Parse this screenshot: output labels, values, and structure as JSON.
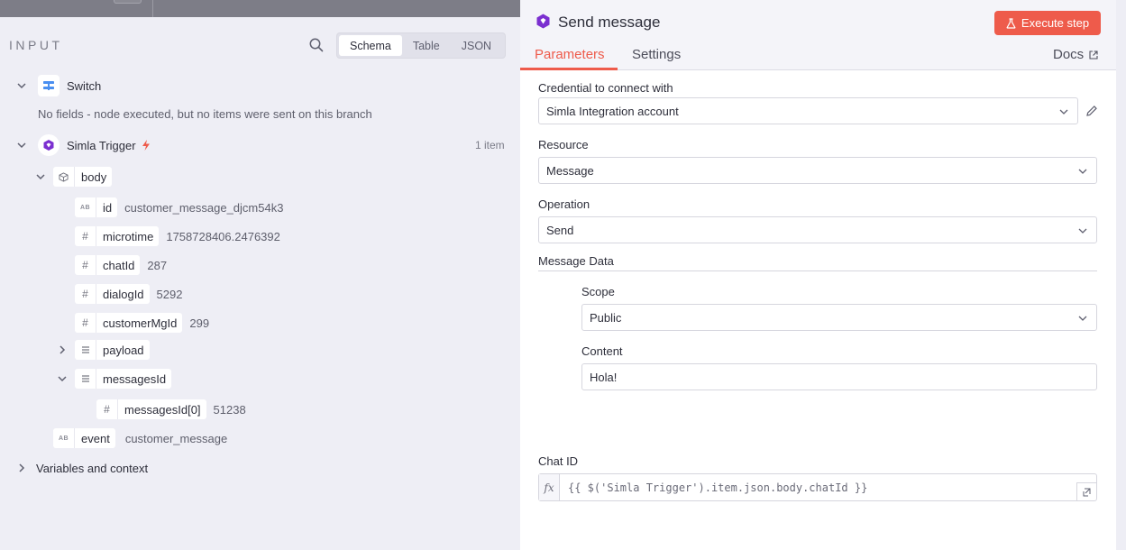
{
  "input_panel": {
    "title": "INPUT",
    "view_tabs": [
      "Schema",
      "Table",
      "JSON"
    ],
    "active_view": "Schema",
    "switch_node": {
      "label": "Switch",
      "message": "No fields - node executed, but no items were sent on this branch"
    },
    "trigger_node": {
      "label": "Simla Trigger",
      "count": "1 item"
    },
    "body_label": "body",
    "fields": [
      {
        "type": "AB",
        "name": "id",
        "value": "customer_message_djcm54k3"
      },
      {
        "type": "#",
        "name": "microtime",
        "value": "1758728406.2476392"
      },
      {
        "type": "#",
        "name": "chatId",
        "value": "287"
      },
      {
        "type": "#",
        "name": "dialogId",
        "value": "5292"
      },
      {
        "type": "#",
        "name": "customerMgId",
        "value": "299"
      }
    ],
    "payload_label": "payload",
    "messages_label": "messagesId",
    "messages_item": {
      "type": "#",
      "name": "messagesId[0]",
      "value": "51238"
    },
    "event": {
      "type": "AB",
      "name": "event",
      "value": "customer_message"
    },
    "variables_label": "Variables and context"
  },
  "node_panel": {
    "title": "Send message",
    "execute_label": "Execute step",
    "tabs": [
      "Parameters",
      "Settings"
    ],
    "active_tab": "Parameters",
    "docs_label": "Docs",
    "credential_label": "Credential to connect with",
    "credential_value": "Simla Integration account",
    "resource_label": "Resource",
    "resource_value": "Message",
    "operation_label": "Operation",
    "operation_value": "Send",
    "message_data_label": "Message Data",
    "scope_label": "Scope",
    "scope_value": "Public",
    "content_label": "Content",
    "content_value": "Hola!",
    "chat_id_label": "Chat ID",
    "chat_id_expression": "{{ $('Simla Trigger').item.json.body.chatId }}",
    "fx_label": "fx"
  },
  "colors": {
    "accent": "#ee5b4b",
    "trigger_icon": "#7b2fd0",
    "switch_icon": "#4a8ff0"
  }
}
